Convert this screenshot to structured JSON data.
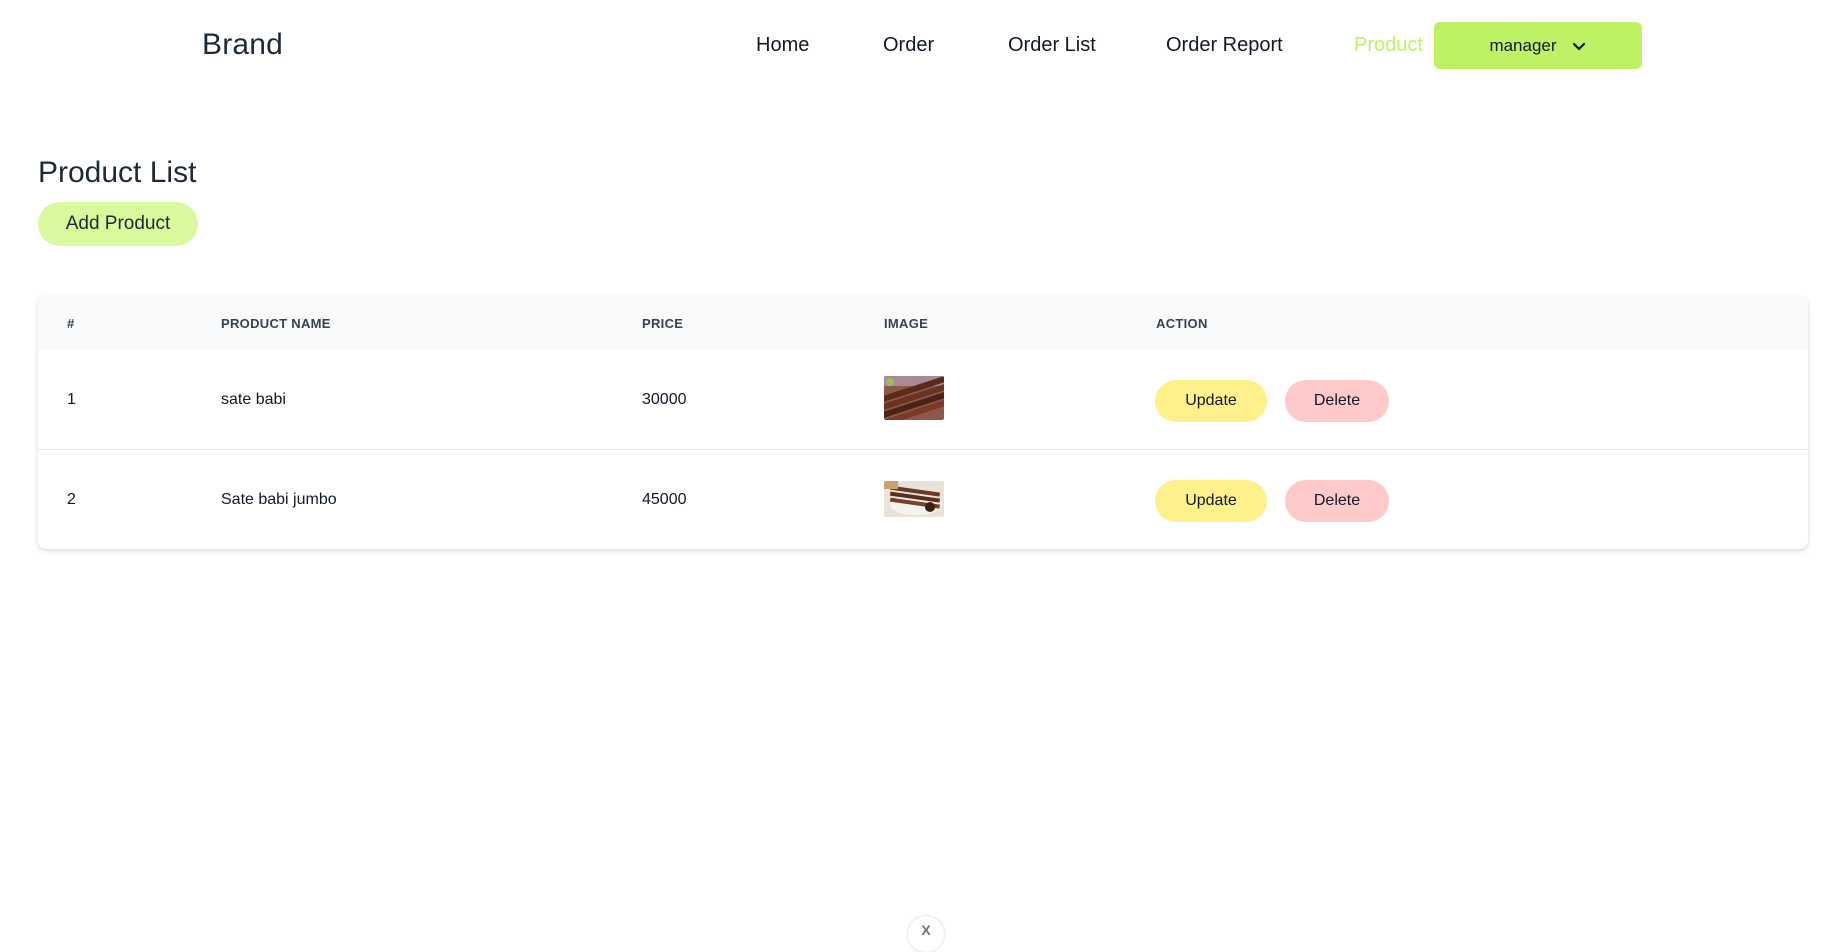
{
  "navbar": {
    "brand": "Brand",
    "links": [
      "Home",
      "Order",
      "Order List",
      "Order Report",
      "Product"
    ],
    "active_link": "Product",
    "user_menu": {
      "label": "manager",
      "icon": "chevron-down-icon"
    }
  },
  "page": {
    "title": "Product List",
    "add_button": "Add Product"
  },
  "table": {
    "headers": [
      "#",
      "PRODUCT NAME",
      "PRICE",
      "IMAGE",
      "ACTION"
    ],
    "rows": [
      {
        "index": "1",
        "name": "sate babi",
        "price": "30000",
        "image": "sate-babi-thumbnail",
        "actions": [
          "Update",
          "Delete"
        ]
      },
      {
        "index": "2",
        "name": "Sate babi jumbo",
        "price": "45000",
        "image": "sate-babi-jumbo-thumbnail",
        "actions": [
          "Update",
          "Delete"
        ]
      }
    ]
  },
  "floating": {
    "label": "X"
  },
  "colors": {
    "accent": "#bef264",
    "add_button": "#d9f99d",
    "update": "#fef08a",
    "delete": "#fecaca"
  }
}
